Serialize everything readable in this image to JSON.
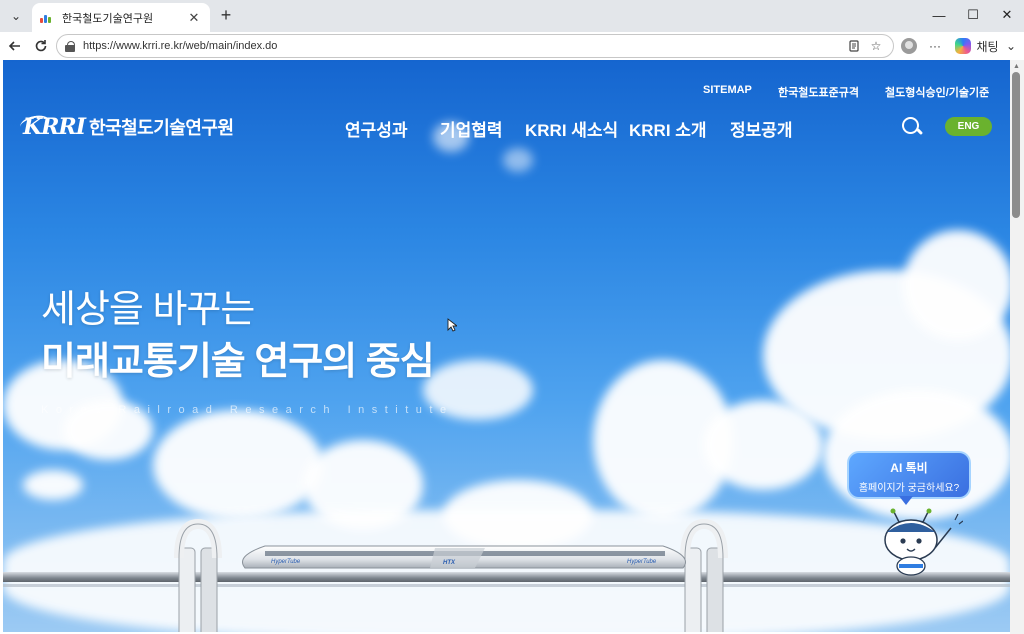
{
  "browser": {
    "tab": {
      "title": "한국철도기술연구원",
      "close_glyph": "✕"
    },
    "new_tab_glyph": "+",
    "tab_menu_glyph": "⌄",
    "window_controls": {
      "minimize": "—",
      "maximize": "☐",
      "close": "✕"
    },
    "address": {
      "url": "https://www.krri.re.kr/web/main/index.do"
    },
    "toolbar": {
      "chat_label": "채팅",
      "more_glyph": "···"
    }
  },
  "site": {
    "utility_links": [
      "SITEMAP",
      "한국철도표준규격",
      "철도형식승인/기술기준"
    ],
    "logo": {
      "mark": "KRRI",
      "name": "한국철도기술연구원"
    },
    "gnb": [
      "연구성과",
      "기업협력",
      "KRRI 새소식",
      "KRRI 소개",
      "정보공개"
    ],
    "lang_button": "ENG",
    "hero": {
      "line1": "세상을 바꾸는",
      "line2": "미래교통기술 연구의 중심",
      "english": "Korea Railroad Research Institute"
    },
    "train_labels": [
      "HyperTube",
      "HTX",
      "HyperTube"
    ],
    "chatbot": {
      "title": "AI 톡비",
      "subtitle": "홈페이지가 궁금하세요?"
    }
  },
  "colors": {
    "sky_top": "#1565cf",
    "eng_button": "#6ab22e",
    "chatbot": "#3a6fe0"
  }
}
